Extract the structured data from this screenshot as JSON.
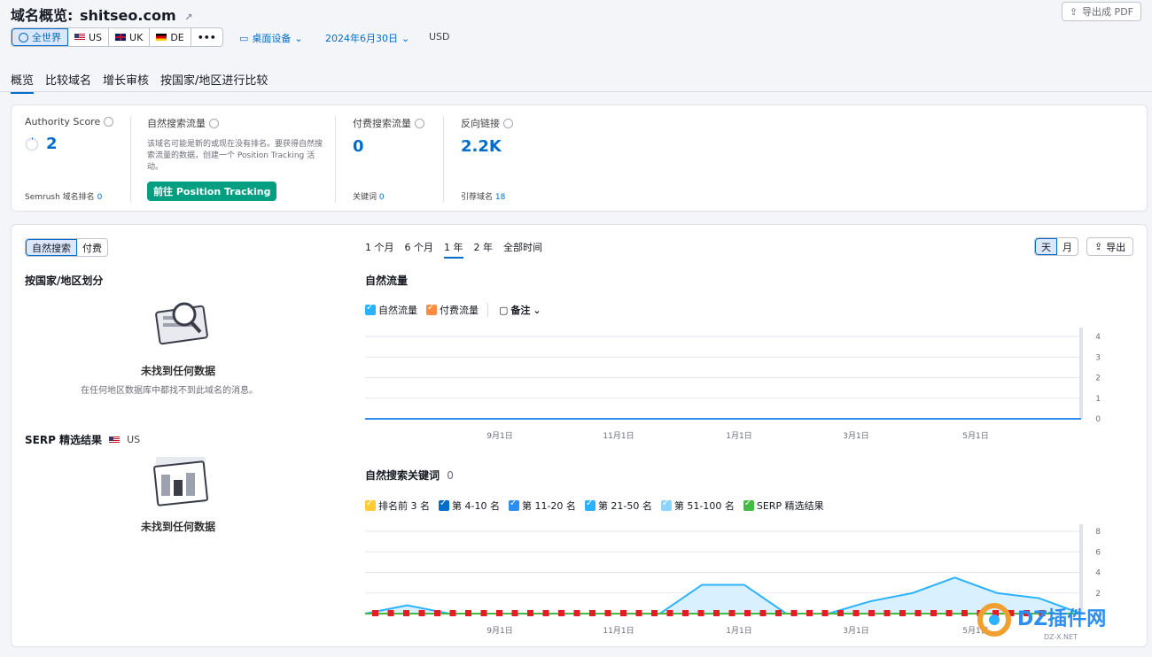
{
  "header": {
    "title": "域名概览:",
    "domain": "shitseo.com",
    "export_pdf": "导出成 PDF"
  },
  "databases": {
    "items": [
      {
        "label": "全世界",
        "icon": "globe-icon",
        "active": true
      },
      {
        "label": "US",
        "icon": "flag-us"
      },
      {
        "label": "UK",
        "icon": "flag-uk"
      },
      {
        "label": "DE",
        "icon": "flag-de"
      },
      {
        "label": "•••",
        "icon": "more-icon"
      }
    ],
    "device": "桌面设备",
    "date": "2024年6月30日",
    "currency": "USD"
  },
  "tabs": [
    "概览",
    "比较域名",
    "增长审核",
    "按国家/地区进行比较"
  ],
  "metrics": {
    "authority": {
      "label": "Authority Score",
      "value": "2",
      "sub_label": "Semrush 域名排名",
      "sub_value": "0"
    },
    "organic": {
      "label": "自然搜索流量",
      "note": "该域名可能是新的或现在没有排名。要获得自然搜索流量的数据，创建一个 Position Tracking 活动。",
      "button": "前往 Position Tracking"
    },
    "paid": {
      "label": "付费搜索流量",
      "value": "0",
      "sub_label": "关键词",
      "sub_value": "0"
    },
    "backlinks": {
      "label": "反向链接",
      "value": "2.2K",
      "sub_label": "引荐域名",
      "sub_value": "18"
    }
  },
  "panel": {
    "type_toggle": [
      "自然搜索",
      "付费"
    ],
    "by_country_title": "按国家/地区划分",
    "empty_title": "未找到任何数据",
    "empty_sub": "在任何地区数据库中都找不到此域名的消息。",
    "serp_title": "SERP 精选结果",
    "serp_db": "US",
    "serp_empty": "未找到任何数据",
    "periods": [
      "1 个月",
      "6 个月",
      "1 年",
      "2 年",
      "全部时间"
    ],
    "active_period": "1 年",
    "granularity": [
      "天",
      "月"
    ],
    "export": "导出"
  },
  "chart_data": [
    {
      "type": "line",
      "title": "自然流量",
      "legend": [
        {
          "name": "自然流量",
          "color": "#2bb2ff"
        },
        {
          "name": "付费流量",
          "color": "#ff8c43"
        }
      ],
      "notes_label": "备注",
      "x_ticks": [
        "9月1日",
        "11月1日",
        "1月1日",
        "3月1日",
        "5月1日"
      ],
      "y_ticks": [
        0,
        1,
        2,
        3,
        4
      ],
      "ylim": [
        0,
        4
      ],
      "series": [
        {
          "name": "自然流量",
          "values": [
            0,
            0,
            0,
            0,
            0,
            0,
            0,
            0,
            0,
            0,
            0,
            0
          ]
        }
      ]
    },
    {
      "type": "area",
      "title": "自然搜索关键词",
      "title_value": "0",
      "legend": [
        {
          "name": "排名前 3 名",
          "color": "#ffcc33"
        },
        {
          "name": "第 4-10 名",
          "color": "#006dca"
        },
        {
          "name": "第 11-20 名",
          "color": "#2c8df2"
        },
        {
          "name": "第 21-50 名",
          "color": "#2bb2ff"
        },
        {
          "name": "第 51-100 名",
          "color": "#8ed4ff"
        },
        {
          "name": "SERP 精选结果",
          "color": "#44bb44"
        }
      ],
      "x_ticks": [
        "9月1日",
        "11月1日",
        "1月1日",
        "3月1日",
        "5月1日"
      ],
      "y_ticks": [
        0,
        2,
        4,
        6,
        8
      ],
      "ylim": [
        0,
        8
      ],
      "series": [
        {
          "name": "第 51-100 名",
          "values": [
            0,
            0.8,
            0,
            0,
            0,
            0,
            0,
            0,
            2.8,
            2.8,
            0,
            0,
            1.2,
            2.0,
            3.5,
            2.0,
            1.5,
            0
          ]
        }
      ]
    }
  ]
}
